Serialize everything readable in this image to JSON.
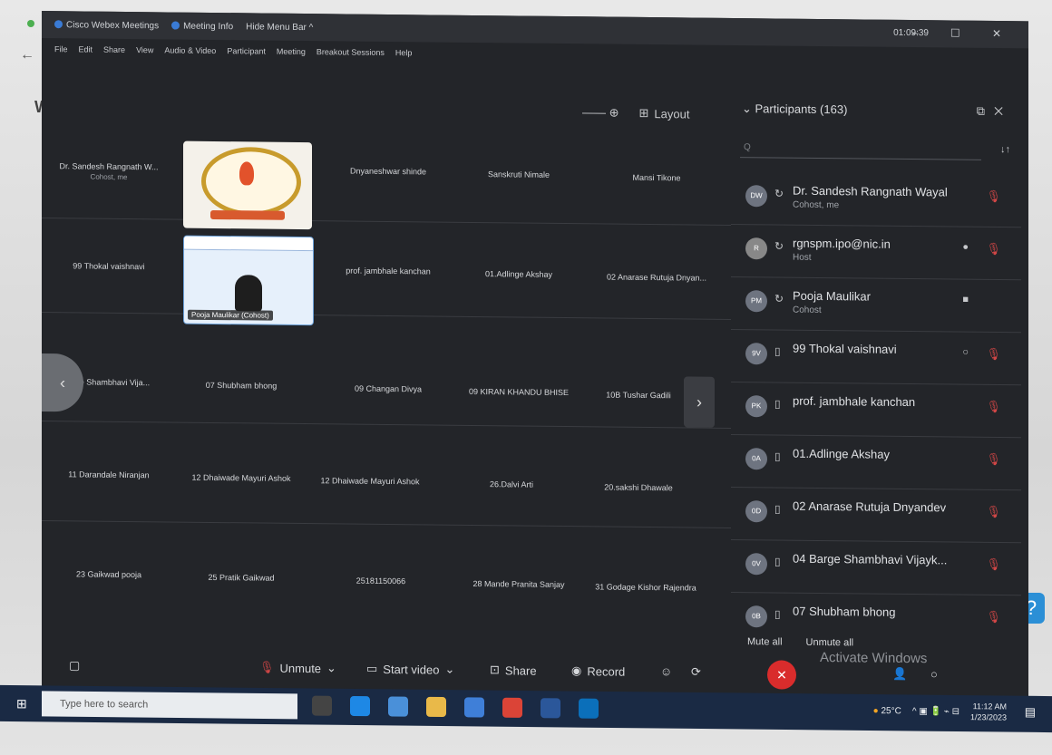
{
  "titlebar": {
    "app": "Cisco Webex Meetings",
    "info": "Meeting Info",
    "hide_menu": "Hide Menu Bar ^",
    "timer": "01:09:39",
    "controls": "– ☐ ✕"
  },
  "menu": [
    "File",
    "Edit",
    "Share",
    "View",
    "Audio & Video",
    "Participant",
    "Meeting",
    "Breakout Sessions",
    "Help"
  ],
  "top_controls": {
    "layout": "Layout"
  },
  "grid": {
    "rows": [
      {
        "cells": [
          {
            "name": "Dr. Sandesh Rangnath W...",
            "role": "Cohost, me"
          },
          {
            "name": "Dnyaneshwar shinde"
          },
          {
            "name": "Sanskruti Nimale"
          },
          {
            "name": "Mansi Tikone"
          }
        ]
      },
      {
        "cells": [
          {
            "name": "99 Thokal vaishnavi"
          },
          {
            "name": "prof. jambhale kanchan"
          },
          {
            "name": "01.Adlinge Akshay"
          },
          {
            "name": "02 Anarase Rutuja Dnyan..."
          }
        ]
      },
      {
        "cells": [
          {
            "name": "ge Shambhavi Vija..."
          },
          {
            "name": "07 Shubham bhong"
          },
          {
            "name": "09 Changan Divya"
          },
          {
            "name": "09 KIRAN KHANDU BHISE"
          },
          {
            "name": "10B Tushar Gadili"
          }
        ]
      },
      {
        "cells": [
          {
            "name": "11 Darandale Niranjan"
          },
          {
            "name": "12 Dhaiwade Mayuri Ashok"
          },
          {
            "name": "12 Dhaiwade Mayuri Ashok"
          },
          {
            "name": "26.Dalvi Arti"
          },
          {
            "name": "20.sakshi Dhawale"
          }
        ]
      },
      {
        "cells": [
          {
            "name": "23 Gaikwad pooja"
          },
          {
            "name": "25 Pratik Gaikwad"
          },
          {
            "name": "25181150066"
          },
          {
            "name": "28 Mande Pranita Sanjay"
          },
          {
            "name": "31 Godage Kishor Rajendra"
          }
        ]
      }
    ],
    "video_caption": "Pooja Maulikar (Cohost)"
  },
  "participants": {
    "header": "Participants (163)",
    "search_placeholder": "Q",
    "sort": "↓↑",
    "list": [
      {
        "initials": "DW",
        "name": "Dr. Sandesh Rangnath Wayal",
        "role": "Cohost, me"
      },
      {
        "initials": "R",
        "name": "rgnspm.ipo@nic.in",
        "role": "Host"
      },
      {
        "initials": "PM",
        "name": "Pooja Maulikar",
        "role": "Cohost"
      },
      {
        "initials": "9V",
        "name": "99 Thokal vaishnavi",
        "role": ""
      },
      {
        "initials": "PK",
        "name": "prof. jambhale kanchan",
        "role": ""
      },
      {
        "initials": "0A",
        "name": "01.Adlinge Akshay",
        "role": ""
      },
      {
        "initials": "0D",
        "name": "02 Anarase Rutuja Dnyandev",
        "role": ""
      },
      {
        "initials": "0V",
        "name": "04 Barge Shambhavi Vijayk...",
        "role": ""
      },
      {
        "initials": "0B",
        "name": "07 Shubham bhong",
        "role": ""
      }
    ],
    "mute_all": "Mute all",
    "unmute_all": "Unmute all"
  },
  "controls": {
    "unmute": "Unmute",
    "start_video": "Start video",
    "share": "Share",
    "record": "Record",
    "watermark": "Activate Windows"
  },
  "taskbar": {
    "search_placeholder": "Type here to search",
    "weather": "25°C",
    "time": "11:12 AM",
    "date": "1/23/2023"
  }
}
